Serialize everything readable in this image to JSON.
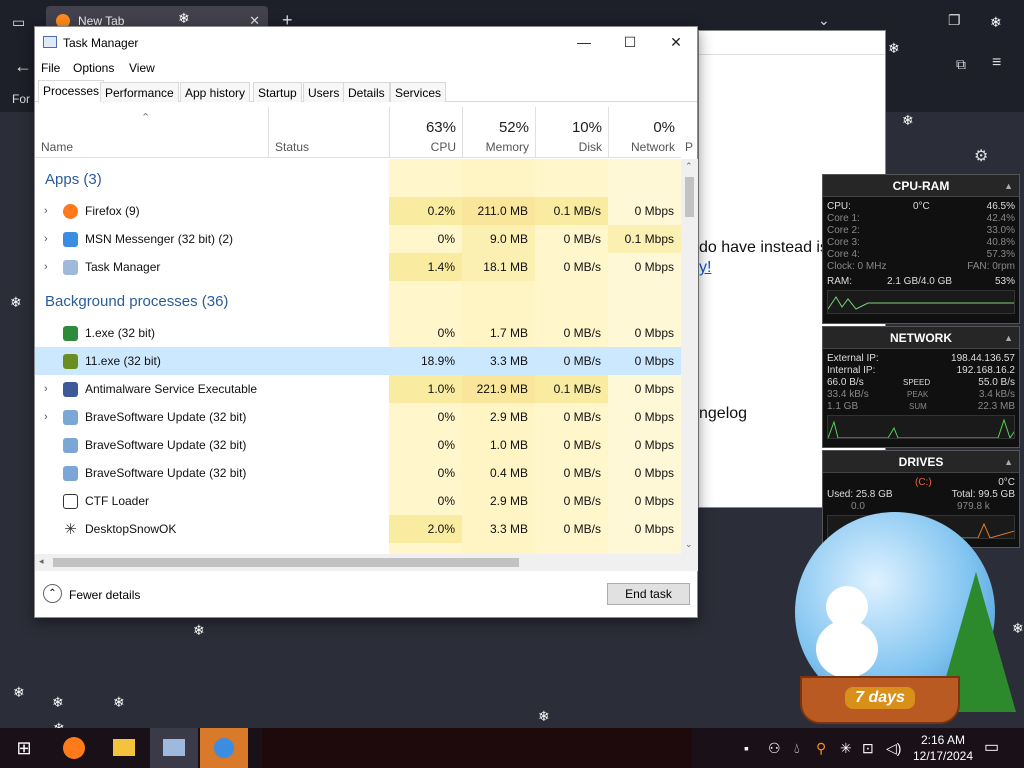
{
  "browser": {
    "tab_title": "New Tab",
    "tab_close": "✕",
    "new_tab": "+",
    "left_label": "For",
    "page_text_1": "do have instead is",
    "page_link_1": "y!",
    "page_text_2": "ngelog"
  },
  "task_manager": {
    "title": "Task Manager",
    "menu": [
      "File",
      "Options",
      "View"
    ],
    "tabs": [
      "Processes",
      "Performance",
      "App history",
      "Startup",
      "Users",
      "Details",
      "Services"
    ],
    "columns": {
      "name": "Name",
      "status": "Status",
      "cpu": {
        "pct": "63%",
        "label": "CPU"
      },
      "memory": {
        "pct": "52%",
        "label": "Memory"
      },
      "disk": {
        "pct": "10%",
        "label": "Disk"
      },
      "network": {
        "pct": "0%",
        "label": "Network"
      },
      "extra": "P"
    },
    "group_apps": "Apps (3)",
    "group_bg": "Background processes (36)",
    "apps": [
      {
        "name": "Firefox (9)",
        "cpu": "0.2%",
        "memory": "211.0 MB",
        "disk": "0.1 MB/s",
        "network": "0 Mbps"
      },
      {
        "name": "MSN Messenger (32 bit) (2)",
        "cpu": "0%",
        "memory": "9.0 MB",
        "disk": "0 MB/s",
        "network": "0.1 Mbps"
      },
      {
        "name": "Task Manager",
        "cpu": "1.4%",
        "memory": "18.1 MB",
        "disk": "0 MB/s",
        "network": "0 Mbps"
      }
    ],
    "background": [
      {
        "name": "1.exe (32 bit)",
        "cpu": "0%",
        "memory": "1.7 MB",
        "disk": "0 MB/s",
        "network": "0 Mbps"
      },
      {
        "name": "11.exe (32 bit)",
        "cpu": "18.9%",
        "memory": "3.3 MB",
        "disk": "0 MB/s",
        "network": "0 Mbps"
      },
      {
        "name": "Antimalware Service Executable",
        "cpu": "1.0%",
        "memory": "221.9 MB",
        "disk": "0.1 MB/s",
        "network": "0 Mbps"
      },
      {
        "name": "BraveSoftware Update (32 bit)",
        "cpu": "0%",
        "memory": "2.9 MB",
        "disk": "0 MB/s",
        "network": "0 Mbps"
      },
      {
        "name": "BraveSoftware Update (32 bit)",
        "cpu": "0%",
        "memory": "1.0 MB",
        "disk": "0 MB/s",
        "network": "0 Mbps"
      },
      {
        "name": "BraveSoftware Update (32 bit)",
        "cpu": "0%",
        "memory": "0.4 MB",
        "disk": "0 MB/s",
        "network": "0 Mbps"
      },
      {
        "name": "CTF Loader",
        "cpu": "0%",
        "memory": "2.9 MB",
        "disk": "0 MB/s",
        "network": "0 Mbps"
      },
      {
        "name": "DesktopSnowOK",
        "cpu": "2.0%",
        "memory": "3.3 MB",
        "disk": "0 MB/s",
        "network": "0 Mbps"
      }
    ],
    "fewer_details": "Fewer details",
    "end_task": "End task"
  },
  "gadget_cpu": {
    "title": "CPU-RAM",
    "cpu_label": "CPU:",
    "cpu_temp": "0°C",
    "cpu_pct": "46.5%",
    "cores": [
      {
        "label": "Core 1:",
        "val": "42.4%"
      },
      {
        "label": "Core 2:",
        "val": "33.0%"
      },
      {
        "label": "Core 3:",
        "val": "40.8%"
      },
      {
        "label": "Core 4:",
        "val": "57.3%"
      }
    ],
    "clock": "Clock: 0 MHz",
    "fan": "FAN: 0rpm",
    "ram_label": "RAM:",
    "ram_used": "2.1 GB/4.0 GB",
    "ram_pct": "53%"
  },
  "gadget_net": {
    "title": "NETWORK",
    "ext_label": "External IP:",
    "ext_ip": "198.44.136.57",
    "int_label": "Internal IP:",
    "int_ip": "192.168.16.2",
    "speed_down": "66.0 B/s",
    "speed_label": "SPEED",
    "speed_up": "55.0 B/s",
    "peak_down": "33.4 kB/s",
    "peak_label": "PEAK",
    "peak_up": "3.4 kB/s",
    "sum_down": "1.1 GB",
    "sum_label": "SUM",
    "sum_up": "22.3 MB"
  },
  "gadget_drives": {
    "title": "DRIVES",
    "drive": "(C:)",
    "temp": "0°C",
    "used": "Used: 25.8 GB",
    "total": "Total: 99.5 GB",
    "read": "0.0",
    "write": "979.8 k"
  },
  "globe": {
    "days": "7 days"
  },
  "clock": {
    "time": "2:16 AM",
    "date": "12/17/2024"
  },
  "colors": {
    "accent": "#2a5c9a",
    "heat": "#fff4c4",
    "heat_strong": "#f9eca0",
    "selected": "#cce8ff"
  }
}
